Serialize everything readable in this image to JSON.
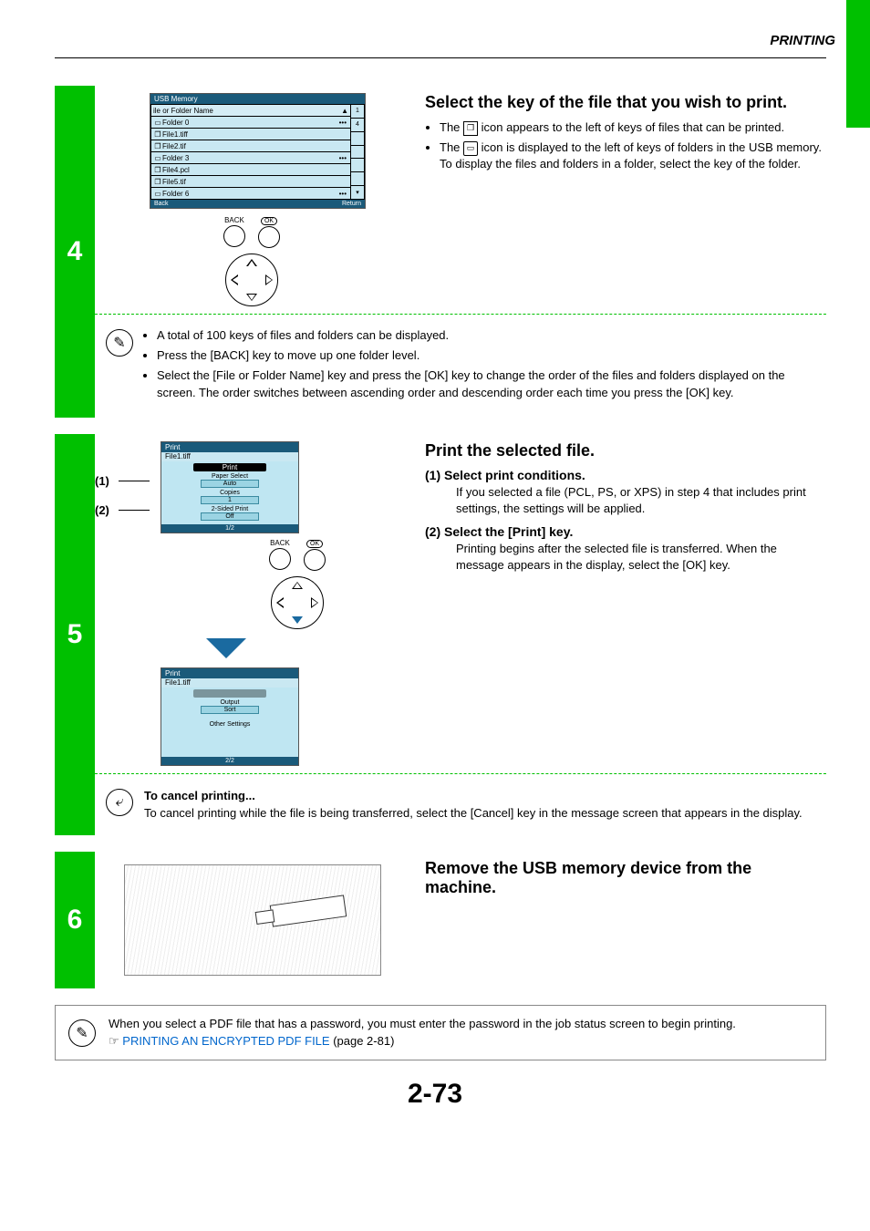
{
  "header": {
    "section": "PRINTING"
  },
  "page_number": "2-73",
  "step4": {
    "num": "4",
    "title": "Select the key of the file that you wish to print.",
    "bullets": [
      {
        "pre": "The ",
        "post_icon": " icon appears to the left of keys of files that can be printed."
      },
      {
        "pre": "The ",
        "post_icon": " icon is displayed to the left of keys of folders in the USB memory. To display the files and folders in a folder, select the key of the folder."
      }
    ],
    "screen": {
      "title": "USB Memory",
      "header_row": "ile or Folder Name",
      "rows": [
        {
          "icon": "folder",
          "name": "Folder 0",
          "dots": true
        },
        {
          "icon": "file",
          "name": "File1.tiff"
        },
        {
          "icon": "file",
          "name": "File2.tif"
        },
        {
          "icon": "folder",
          "name": "Folder 3",
          "dots": true
        },
        {
          "icon": "file",
          "name": "File4.pcl"
        },
        {
          "icon": "file",
          "name": "File5.tif"
        },
        {
          "icon": "folder",
          "name": "Folder 6",
          "dots": true
        }
      ],
      "side_top": "1",
      "side_count": "4",
      "footer_left": "Back",
      "footer_right": "Return"
    },
    "panel": {
      "back": "BACK",
      "ok": "OK"
    },
    "note_bullets": [
      "A total of 100 keys of files and folders can be displayed.",
      "Press the [BACK] key to move up one folder level.",
      "Select the [File or Folder Name] key and press the [OK] key to change the order of the files and folders displayed on the screen. The order switches between ascending order and descending order each time you press the [OK] key."
    ]
  },
  "step5": {
    "num": "5",
    "title": "Print the selected file.",
    "callout1": "(1)",
    "callout2": "(2)",
    "sub1_h": "(1)  Select print conditions.",
    "sub1_p": "If you selected a file (PCL, PS, or XPS) in step 4 that includes print settings, the settings will be applied.",
    "sub2_h": "(2)  Select the [Print] key.",
    "sub2_p": "Printing begins after the selected file is transferred. When the message appears in the display, select the [OK] key.",
    "screen1": {
      "title": "Print",
      "file": "File1.tiff",
      "print_btn": "Print",
      "paper_lbl": "Paper Select",
      "paper_val": "Auto",
      "copies_lbl": "Copies",
      "copies_val": "1",
      "twosided_lbl": "2-Sided Print",
      "twosided_val": "Off",
      "page": "1/2"
    },
    "screen2": {
      "title": "Print",
      "file": "File1.tiff",
      "output_lbl": "Output",
      "output_val": "Sort",
      "other": "Other Settings",
      "page": "2/2"
    },
    "panel": {
      "back": "BACK",
      "ok": "OK"
    },
    "cancel_h": "To cancel printing...",
    "cancel_p": "To cancel printing while the file is being transferred, select the [Cancel] key in the message screen that appears in the display."
  },
  "step6": {
    "num": "6",
    "title": "Remove the USB memory device from the machine."
  },
  "footer_note": {
    "text": "When you select a PDF file that has a password, you must enter the password in the job status screen to begin printing.",
    "pointer": "☞",
    "link": "PRINTING AN ENCRYPTED PDF FILE",
    "link_suffix": " (page 2-81)"
  }
}
